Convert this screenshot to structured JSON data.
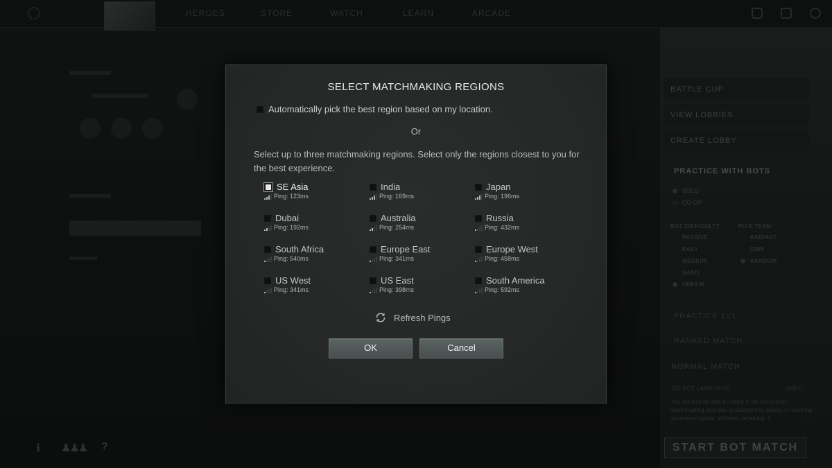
{
  "background": {
    "nav": [
      "HEROES",
      "STORE",
      "WATCH",
      "LEARN",
      "ARCADE"
    ],
    "right_panel": {
      "battle_cup": "BATTLE CUP",
      "view_lobbies": "VIEW LOBBIES",
      "create_lobby": "CREATE LOBBY",
      "practice_with_bots": "PRACTICE WITH BOTS",
      "mode_solo": "SOLO",
      "mode_coop": "CO-OP",
      "bot_difficulty": "BOT DIFFICULTY",
      "pick_team": "PICK TEAM",
      "difficulty": [
        "PASSIVE",
        "EASY",
        "MEDIUM",
        "HARD",
        "UNFAIR"
      ],
      "teams": [
        "RADIANT",
        "DIRE",
        "RANDOM"
      ],
      "practice_1v1": "PRACTICE 1V1",
      "ranked_match": "RANKED MATCH",
      "normal_match": "NORMAL MATCH",
      "select_language": "SELECT LANGUAGE",
      "language_value": "(ANY)",
      "notice": "You will only be able to match in the low priority matchmaking pool due to abandoning games or receiving excessive reports. Victories remaining: 4",
      "start_button": "START BOT MATCH"
    }
  },
  "dialog": {
    "title": "SELECT MATCHMAKING REGIONS",
    "auto_pick_label": "Automatically pick the best region based on my location.",
    "or_text": "Or",
    "instructions": "Select up to three matchmaking regions. Select only the regions closest to you for the best experience.",
    "regions": [
      {
        "name": "SE Asia",
        "ping": "Ping: 123ms",
        "signal": 3,
        "selected": true
      },
      {
        "name": "India",
        "ping": "Ping: 169ms",
        "signal": 3,
        "selected": false
      },
      {
        "name": "Japan",
        "ping": "Ping: 196ms",
        "signal": 3,
        "selected": false
      },
      {
        "name": "Dubai",
        "ping": "Ping: 192ms",
        "signal": 2,
        "selected": false
      },
      {
        "name": "Australia",
        "ping": "Ping: 254ms",
        "signal": 2,
        "selected": false
      },
      {
        "name": "Russia",
        "ping": "Ping: 432ms",
        "signal": 1,
        "selected": false
      },
      {
        "name": "South Africa",
        "ping": "Ping: 540ms",
        "signal": 1,
        "selected": false
      },
      {
        "name": "Europe East",
        "ping": "Ping: 341ms",
        "signal": 1,
        "selected": false
      },
      {
        "name": "Europe West",
        "ping": "Ping: 458ms",
        "signal": 1,
        "selected": false
      },
      {
        "name": "US West",
        "ping": "Ping: 341ms",
        "signal": 1,
        "selected": false
      },
      {
        "name": "US East",
        "ping": "Ping: 398ms",
        "signal": 1,
        "selected": false
      },
      {
        "name": "South America",
        "ping": "Ping: 592ms",
        "signal": 1,
        "selected": false
      }
    ],
    "refresh_label": "Refresh Pings",
    "ok_label": "OK",
    "cancel_label": "Cancel"
  },
  "icons": {
    "refresh": "refresh-icon",
    "checkbox": "checkbox",
    "signal": "signal-bars-icon"
  },
  "colors": {
    "dialog_bg": "#272929",
    "button_bg": "#555c5c",
    "text": "#c3c7c7"
  }
}
